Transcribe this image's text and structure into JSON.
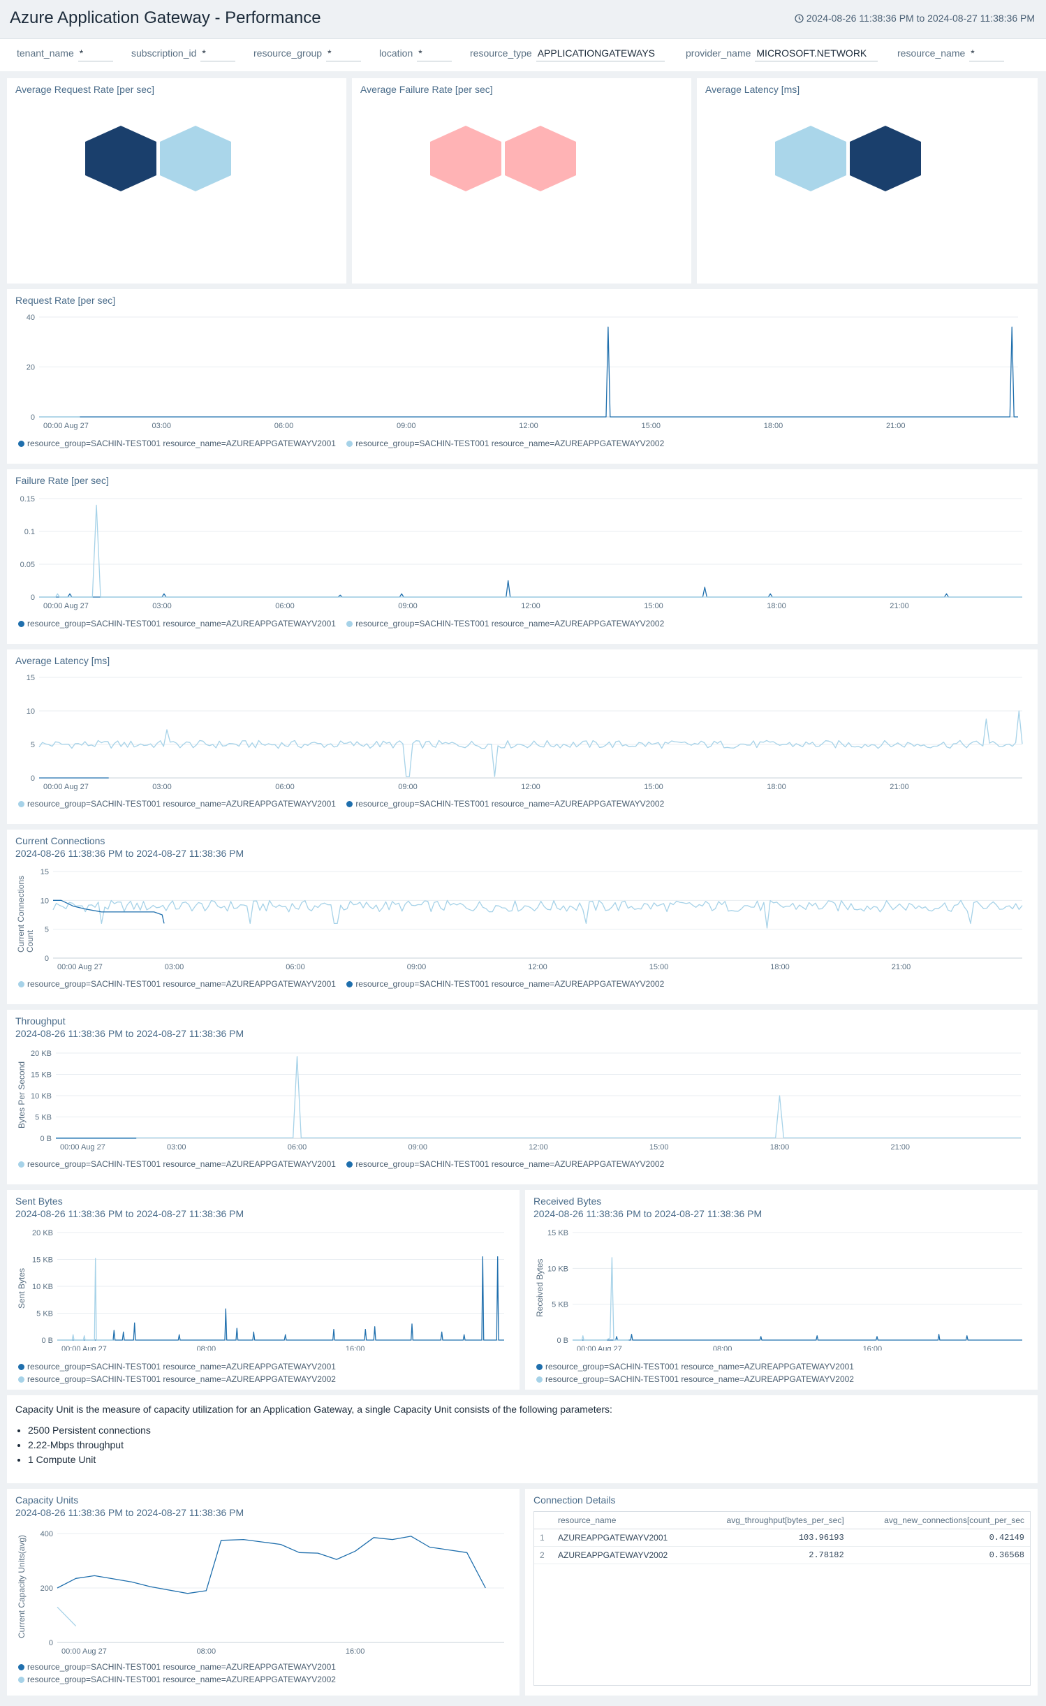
{
  "header": {
    "title": "Azure Application Gateway - Performance",
    "time_range": "2024-08-26 11:38:36 PM to 2024-08-27 11:38:36 PM"
  },
  "filters": [
    {
      "label": "tenant_name",
      "value": "*"
    },
    {
      "label": "subscription_id",
      "value": "*"
    },
    {
      "label": "resource_group",
      "value": "*"
    },
    {
      "label": "location",
      "value": "*"
    },
    {
      "label": "resource_type",
      "value": "APPLICATIONGATEWAYS"
    },
    {
      "label": "provider_name",
      "value": "MICROSOFT.NETWORK"
    },
    {
      "label": "resource_name",
      "value": "*"
    }
  ],
  "colors": {
    "dark_blue": "#1a3f6c",
    "light_blue": "#aad6ea",
    "pink": "#ffb3b5",
    "series_dark": "#1f6fad",
    "series_light": "#a6d2e8"
  },
  "honeycombs": [
    {
      "title": "Average Request Rate [per sec]",
      "cells": [
        "dark",
        "light"
      ]
    },
    {
      "title": "Average Failure Rate [per sec]",
      "cells": [
        "pink",
        "pink"
      ]
    },
    {
      "title": "Average Latency [ms]",
      "cells": [
        "light",
        "dark"
      ]
    }
  ],
  "series_names": {
    "v1": "resource_group=SACHIN-TEST001 resource_name=AZUREAPPGATEWAYV2001",
    "v2": "resource_group=SACHIN-TEST001 resource_name=AZUREAPPGATEWAYV2002"
  },
  "panels": {
    "request_rate": {
      "title": "Request Rate [per sec]"
    },
    "failure_rate": {
      "title": "Failure Rate [per sec]"
    },
    "avg_latency": {
      "title": "Average Latency [ms]"
    },
    "current_connections": {
      "title": "Current Connections",
      "subtitle": "2024-08-26 11:38:36 PM to 2024-08-27 11:38:36 PM",
      "ylabel": "Current Connections Count"
    },
    "throughput": {
      "title": "Throughput",
      "subtitle": "2024-08-26 11:38:36 PM to 2024-08-27 11:38:36 PM",
      "ylabel": "Bytes Per Second"
    },
    "sent_bytes": {
      "title": "Sent Bytes",
      "subtitle": "2024-08-26 11:38:36 PM to 2024-08-27 11:38:36 PM",
      "ylabel": "Sent Bytes"
    },
    "received_bytes": {
      "title": "Received Bytes",
      "subtitle": "2024-08-26 11:38:36 PM to 2024-08-27 11:38:36 PM",
      "ylabel": "Received Bytes"
    },
    "capacity_units": {
      "title": "Capacity Units",
      "subtitle": "2024-08-26 11:38:36 PM to 2024-08-27 11:38:36 PM",
      "ylabel": "Current Capacity Units(avg)"
    },
    "connection_details": {
      "title": "Connection Details"
    }
  },
  "capacity_info": {
    "text": "Capacity Unit is the measure of capacity utilization for an Application Gateway, a single Capacity Unit consists of the following parameters:",
    "items": [
      "2500 Persistent connections",
      "2.22-Mbps throughput",
      "1 Compute Unit"
    ]
  },
  "connection_table": {
    "columns": [
      "resource_name",
      "avg_throughput[bytes_per_sec]",
      "avg_new_connections[count_per_sec"
    ],
    "rows": [
      {
        "n": "1",
        "name": "AZUREAPPGATEWAYV2001",
        "throughput": "103.96193",
        "conn": "0.42149"
      },
      {
        "n": "2",
        "name": "AZUREAPPGATEWAYV2002",
        "throughput": "2.78182",
        "conn": "0.36568"
      }
    ]
  },
  "chart_data": [
    {
      "id": "request_rate",
      "type": "line",
      "xticks": [
        "00:00 Aug 27",
        "03:00",
        "06:00",
        "09:00",
        "12:00",
        "15:00",
        "18:00",
        "21:00"
      ],
      "yticks": [
        "0",
        "20",
        "40"
      ],
      "ylim": [
        0,
        40
      ],
      "xlim": [
        0,
        24
      ],
      "series": [
        {
          "name": "resource_group=SACHIN-TEST001 resource_name=AZUREAPPGATEWAYV2001",
          "color": "#1f6fad",
          "x": [
            0,
            13.9,
            13.95,
            14.0,
            14.1,
            23.8,
            23.85,
            23.9,
            24.0
          ],
          "y": [
            0,
            0,
            36,
            0,
            0,
            0,
            36,
            0,
            0
          ]
        },
        {
          "name": "resource_group=SACHIN-TEST001 resource_name=AZUREAPPGATEWAYV2002",
          "color": "#a6d2e8",
          "x": [
            0,
            1
          ],
          "y": [
            0,
            0
          ]
        }
      ]
    },
    {
      "id": "failure_rate",
      "type": "line",
      "xticks": [
        "00:00 Aug 27",
        "03:00",
        "06:00",
        "09:00",
        "12:00",
        "15:00",
        "18:00",
        "21:00"
      ],
      "yticks": [
        "0",
        "0.05",
        "0.1",
        "0.15"
      ],
      "ylim": [
        0,
        0.15
      ],
      "xlim": [
        0,
        24
      ],
      "series": [
        {
          "name": "resource_group=SACHIN-TEST001 resource_name=AZUREAPPGATEWAYV2001",
          "color": "#1f6fad",
          "x": [
            0,
            0.7,
            0.75,
            0.8,
            3.0,
            3.05,
            3.1,
            7.3,
            7.35,
            7.4,
            8.8,
            8.85,
            8.9,
            11.4,
            11.45,
            11.5,
            16.2,
            16.25,
            16.3,
            17.8,
            17.85,
            17.9,
            22.1,
            22.15,
            22.2,
            24
          ],
          "y": [
            0,
            0,
            0.005,
            0,
            0,
            0.005,
            0,
            0,
            0.003,
            0,
            0,
            0.005,
            0,
            0,
            0.025,
            0,
            0,
            0.015,
            0,
            0,
            0.005,
            0,
            0,
            0.005,
            0,
            0
          ]
        },
        {
          "name": "resource_group=SACHIN-TEST001 resource_name=AZUREAPPGATEWAYV2002",
          "color": "#a6d2e8",
          "x": [
            0,
            0.4,
            0.45,
            0.5,
            1.3,
            1.4,
            1.5,
            1.6,
            24
          ],
          "y": [
            0,
            0,
            0.005,
            0,
            0,
            0.14,
            0,
            0,
            0
          ]
        }
      ]
    },
    {
      "id": "avg_latency",
      "type": "line",
      "xticks": [
        "00:00 Aug 27",
        "03:00",
        "06:00",
        "09:00",
        "12:00",
        "15:00",
        "18:00",
        "21:00"
      ],
      "yticks": [
        "0",
        "5",
        "10",
        "15"
      ],
      "ylim": [
        0,
        15
      ],
      "xlim": [
        0,
        24
      ],
      "series": [
        {
          "name": "resource_group=SACHIN-TEST001 resource_name=AZUREAPPGATEWAYV2001",
          "color": "#a6d2e8",
          "baseline": 5,
          "jitter": 0.6,
          "spikes": [
            [
              3.1,
              7.2
            ],
            [
              9.0,
              0.2
            ],
            [
              11.1,
              0.2
            ],
            [
              23.1,
              8.8
            ],
            [
              23.9,
              10
            ]
          ]
        },
        {
          "name": "resource_group=SACHIN-TEST001 resource_name=AZUREAPPGATEWAYV2002",
          "color": "#1f6fad",
          "x": [
            0,
            1.7
          ],
          "y": [
            0,
            0
          ]
        }
      ]
    },
    {
      "id": "current_connections",
      "type": "line",
      "xticks": [
        "00:00 Aug 27",
        "03:00",
        "06:00",
        "09:00",
        "12:00",
        "15:00",
        "18:00",
        "21:00"
      ],
      "yticks": [
        "0",
        "5",
        "10",
        "15"
      ],
      "ylim": [
        0,
        15
      ],
      "xlim": [
        0,
        24
      ],
      "series": [
        {
          "name": "resource_group=SACHIN-TEST001 resource_name=AZUREAPPGATEWAYV2001",
          "color": "#a6d2e8",
          "baseline": 9,
          "jitter": 1.0,
          "spikes": [
            [
              1.2,
              6
            ],
            [
              4.9,
              6
            ],
            [
              7.0,
              6
            ],
            [
              13.2,
              6
            ],
            [
              17.7,
              5.2
            ],
            [
              22.7,
              6
            ]
          ]
        },
        {
          "name": "resource_group=SACHIN-TEST001 resource_name=AZUREAPPGATEWAYV2002",
          "color": "#1f6fad",
          "x": [
            0,
            0.2,
            0.5,
            0.8,
            1.2,
            1.6,
            2.0,
            2.5,
            2.7,
            2.75
          ],
          "y": [
            10,
            10,
            9,
            8.5,
            8,
            8,
            8,
            8,
            7.5,
            6
          ]
        }
      ]
    },
    {
      "id": "throughput",
      "type": "line",
      "xticks": [
        "00:00 Aug 27",
        "03:00",
        "06:00",
        "09:00",
        "12:00",
        "15:00",
        "18:00",
        "21:00"
      ],
      "yticks": [
        "0 B",
        "5 KB",
        "10 KB",
        "15 KB",
        "20 KB"
      ],
      "ylim": [
        0,
        20
      ],
      "xlim": [
        0,
        24
      ],
      "series": [
        {
          "name": "resource_group=SACHIN-TEST001 resource_name=AZUREAPPGATEWAYV2001",
          "color": "#a6d2e8",
          "x": [
            0,
            5.9,
            6.0,
            6.1,
            17.9,
            18.0,
            18.1,
            24
          ],
          "y": [
            0.1,
            0.1,
            19.2,
            0.1,
            0.1,
            10,
            0.1,
            0.1
          ]
        },
        {
          "name": "resource_group=SACHIN-TEST001 resource_name=AZUREAPPGATEWAYV2002",
          "color": "#1f6fad",
          "x": [
            0,
            2.0
          ],
          "y": [
            0,
            0
          ]
        }
      ]
    },
    {
      "id": "sent_bytes",
      "type": "line",
      "xticks": [
        "00:00 Aug 27",
        "08:00",
        "16:00"
      ],
      "yticks": [
        "0 B",
        "5 KB",
        "10 KB",
        "15 KB",
        "20 KB"
      ],
      "ylim": [
        0,
        20
      ],
      "xlim": [
        0,
        24
      ],
      "series": [
        {
          "name": "resource_group=SACHIN-TEST001 resource_name=AZUREAPPGATEWAYV2001",
          "color": "#1f6fad",
          "x": [
            0,
            3.0,
            3.05,
            3.1,
            3.5,
            3.55,
            3.6,
            4.1,
            4.15,
            4.2,
            6.5,
            6.55,
            6.6,
            9.0,
            9.05,
            9.1,
            9.6,
            9.65,
            9.7,
            10.5,
            10.55,
            10.6,
            12.2,
            12.25,
            12.3,
            14.8,
            14.85,
            14.9,
            16.5,
            16.55,
            16.6,
            17.0,
            17.05,
            17.1,
            19.0,
            19.05,
            19.1,
            20.6,
            20.65,
            20.7,
            21.8,
            21.85,
            21.9,
            22.8,
            22.85,
            22.9,
            23.6,
            23.65,
            23.7,
            24
          ],
          "y": [
            0,
            0,
            1.8,
            0,
            0,
            1.5,
            0,
            0,
            3.2,
            0,
            0,
            1.0,
            0,
            0,
            5.8,
            0,
            0,
            2.2,
            0,
            0,
            1.5,
            0,
            0,
            1.0,
            0,
            0,
            2.0,
            0,
            0,
            2.0,
            0,
            0,
            2.5,
            0,
            0,
            3.0,
            0,
            0,
            1.5,
            0,
            0,
            1.0,
            0,
            0,
            15.5,
            0,
            0,
            15.5,
            0,
            0
          ]
        },
        {
          "name": "resource_group=SACHIN-TEST001 resource_name=AZUREAPPGATEWAYV2002",
          "color": "#a6d2e8",
          "x": [
            0,
            0.8,
            0.85,
            0.9,
            1.4,
            1.45,
            1.5,
            2.0,
            2.05,
            2.1,
            3.0
          ],
          "y": [
            0,
            0,
            1.0,
            0,
            0,
            0.8,
            0,
            0,
            15.2,
            0,
            0
          ]
        }
      ]
    },
    {
      "id": "received_bytes",
      "type": "line",
      "xticks": [
        "00:00 Aug 27",
        "08:00",
        "16:00"
      ],
      "yticks": [
        "0 B",
        "5 KB",
        "10 KB",
        "15 KB"
      ],
      "ylim": [
        0,
        15
      ],
      "xlim": [
        0,
        24
      ],
      "series": [
        {
          "name": "resource_group=SACHIN-TEST001 resource_name=AZUREAPPGATEWAYV2001",
          "color": "#1f6fad",
          "x": [
            0,
            2.3,
            2.35,
            2.4,
            3.1,
            3.15,
            3.2,
            10.0,
            10.05,
            10.1,
            13.0,
            13.05,
            13.1,
            16.2,
            16.25,
            16.3,
            19.5,
            19.55,
            19.6,
            21.0,
            21.05,
            21.1,
            24
          ],
          "y": [
            0,
            0,
            0.5,
            0,
            0,
            0.8,
            0,
            0,
            0.5,
            0,
            0,
            0.6,
            0,
            0,
            0.5,
            0,
            0,
            0.8,
            0,
            0,
            0.6,
            0,
            0
          ]
        },
        {
          "name": "resource_group=SACHIN-TEST001 resource_name=AZUREAPPGATEWAYV2002",
          "color": "#a6d2e8",
          "x": [
            0,
            0.5,
            0.55,
            0.6,
            1.8,
            2.0,
            2.1,
            2.2,
            3.0
          ],
          "y": [
            0,
            0,
            0.6,
            0,
            0,
            0.3,
            11.5,
            0,
            0
          ]
        }
      ]
    },
    {
      "id": "capacity_units",
      "type": "line",
      "xticks": [
        "00:00 Aug 27",
        "08:00",
        "16:00"
      ],
      "yticks": [
        "0",
        "200",
        "400"
      ],
      "ylim": [
        0,
        400
      ],
      "xlim": [
        0,
        24
      ],
      "series": [
        {
          "name": "resource_group=SACHIN-TEST001 resource_name=AZUREAPPGATEWAYV2001",
          "color": "#1f6fad",
          "x": [
            0,
            1,
            2,
            4,
            5,
            7,
            8,
            8.8,
            10,
            12,
            13,
            14,
            15,
            16,
            17,
            18,
            19,
            20,
            22,
            23
          ],
          "y": [
            200,
            235,
            245,
            222,
            205,
            180,
            190,
            375,
            378,
            360,
            330,
            328,
            305,
            335,
            385,
            378,
            390,
            350,
            330,
            200
          ]
        },
        {
          "name": "resource_group=SACHIN-TEST001 resource_name=AZUREAPPGATEWAYV2002",
          "color": "#a6d2e8",
          "x": [
            0,
            1
          ],
          "y": [
            130,
            60
          ]
        }
      ]
    }
  ]
}
